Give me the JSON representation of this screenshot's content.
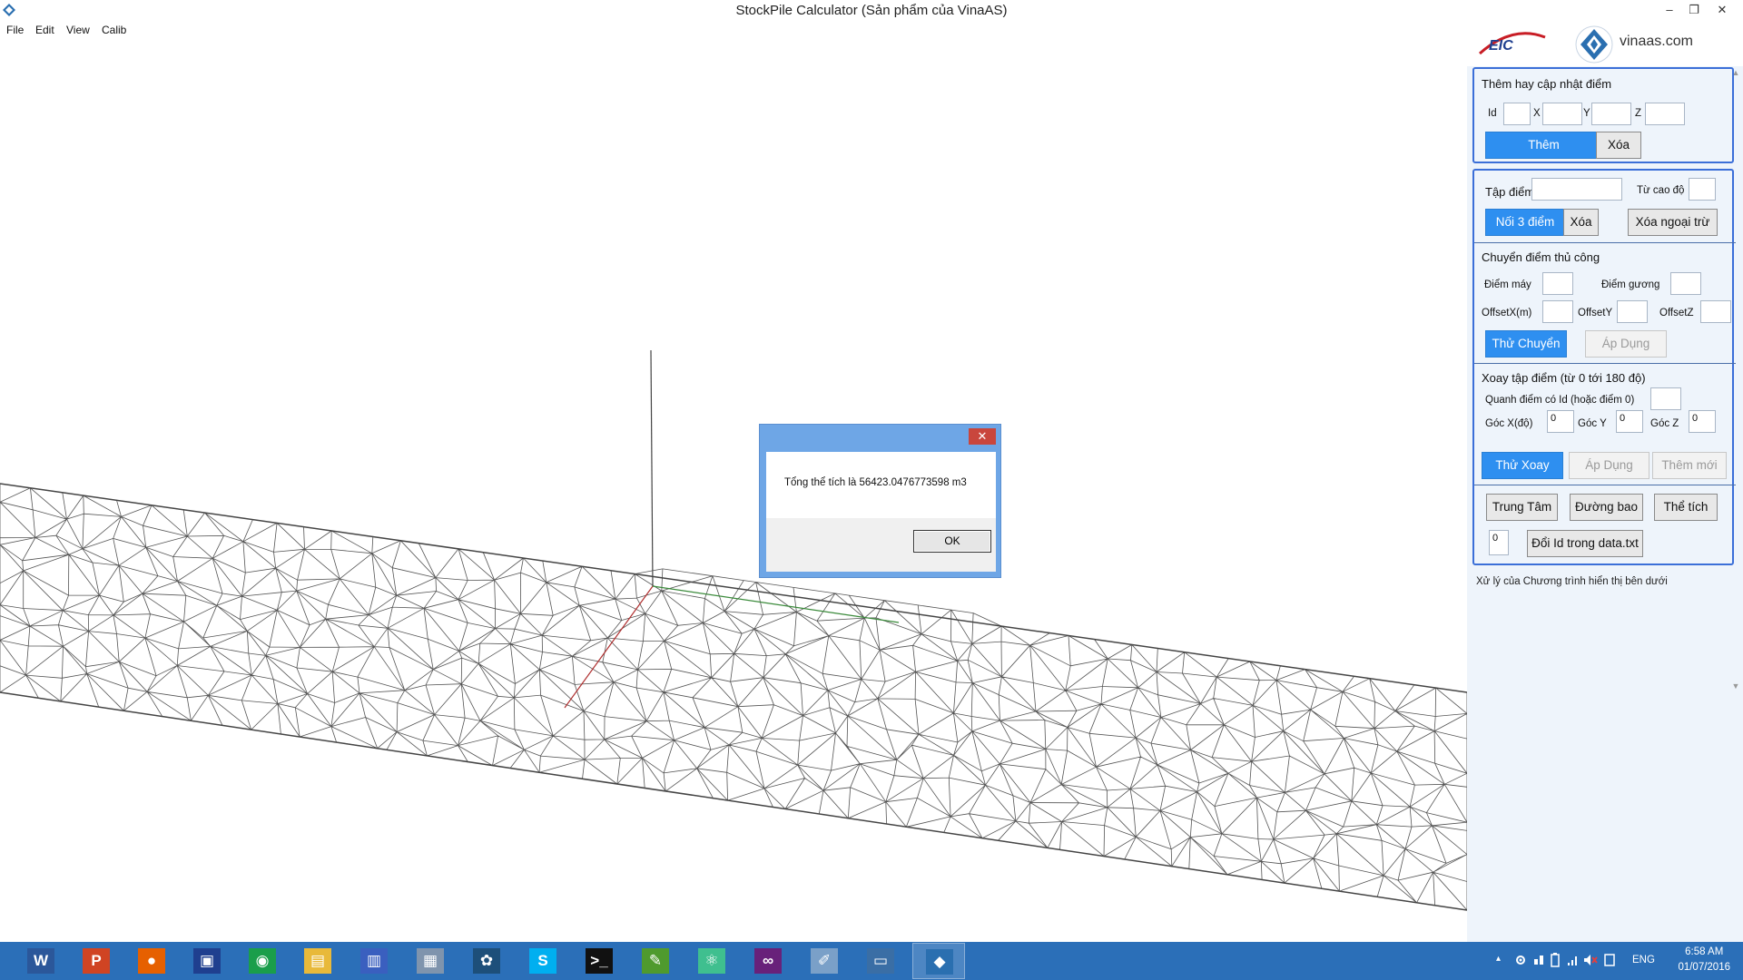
{
  "window": {
    "title": "StockPile Calculator (Sản phẩm của VinaAS)",
    "minimize_glyph": "–",
    "restore_glyph": "❐",
    "close_glyph": "✕"
  },
  "menu": [
    "File",
    "Edit",
    "View",
    "Calib"
  ],
  "logos": {
    "eic": "EIC",
    "vinaas": "vinaas.com"
  },
  "add_point": {
    "title": "Thêm hay cập nhật điểm",
    "id_label": "Id",
    "x_label": "X",
    "y_label": "Y",
    "z_label": "Z",
    "id_value": "",
    "x_value": "",
    "y_value": "",
    "z_value": "",
    "add_button": "Thêm",
    "delete_button": "Xóa"
  },
  "point_set": {
    "label": "Tập điểm",
    "value": "",
    "from_elevation_label": "Từ cao độ",
    "from_elevation_value": "",
    "connect3_button": "Nối 3 điểm",
    "delete_button": "Xóa",
    "delete_except_button": "Xóa ngoại trừ"
  },
  "manual_move": {
    "title": "Chuyển điểm thủ công",
    "machine_point_label": "Điểm máy",
    "mirror_point_label": "Điểm gương",
    "offset_x_label": "OffsetX(m)",
    "offset_y_label": "OffsetY",
    "offset_z_label": "OffsetZ",
    "try_button": "Thử Chuyển",
    "apply_button": "Áp Dụng"
  },
  "rotate": {
    "title": "Xoay tập điểm (từ 0 tới 180 độ)",
    "around_label": "Quanh điểm có Id (hoặc điểm 0)",
    "angle_x_label": "Góc X(độ)",
    "angle_y_label": "Góc Y",
    "angle_z_label": "Góc Z",
    "angle_x_value": "0",
    "angle_y_value": "0",
    "angle_z_value": "0",
    "try_button": "Thử Xoay",
    "apply_button": "Áp Dụng",
    "add_new_button": "Thêm mới"
  },
  "tools": {
    "center_button": "Trung Tâm",
    "boundary_button": "Đường bao",
    "volume_button": "Thể tích",
    "id_value": "0",
    "change_id_button": "Đổi Id trong data.txt"
  },
  "status_text": "Xử lý của Chương trình hiển thị bên dưới",
  "dialog": {
    "message": "Tổng thể tích là 56423.0476773598 m3",
    "ok_button": "OK",
    "close_glyph": "✕"
  },
  "taskbar": {
    "apps": [
      {
        "name": "word-icon",
        "glyph": "W",
        "color": "#2b579a"
      },
      {
        "name": "powerpoint-icon",
        "glyph": "P",
        "color": "#d04423"
      },
      {
        "name": "firefox-icon",
        "glyph": "●",
        "color": "#e66000"
      },
      {
        "name": "save-disk-icon",
        "glyph": "▣",
        "color": "#1f3f8f"
      },
      {
        "name": "chrome-icon",
        "glyph": "◉",
        "color": "#1a9e4b"
      },
      {
        "name": "file-explorer-icon",
        "glyph": "▤",
        "color": "#e8b93a"
      },
      {
        "name": "network-computer-icon",
        "glyph": "▥",
        "color": "#3a5fbf"
      },
      {
        "name": "image-viewer-icon",
        "glyph": "▦",
        "color": "#7f94ad"
      },
      {
        "name": "tree-app-icon",
        "glyph": "✿",
        "color": "#1d4f7a"
      },
      {
        "name": "skype-icon",
        "glyph": "S",
        "color": "#00aff0"
      },
      {
        "name": "command-prompt-icon",
        "glyph": ">_",
        "color": "#111111"
      },
      {
        "name": "chart-notepad-icon",
        "glyph": "✎",
        "color": "#4f9a2e"
      },
      {
        "name": "atom-editor-icon",
        "glyph": "⚛",
        "color": "#3fbf8f"
      },
      {
        "name": "visual-studio-icon",
        "glyph": "∞",
        "color": "#68217a"
      },
      {
        "name": "paint-icon",
        "glyph": "✐",
        "color": "#7aa0c8"
      },
      {
        "name": "remote-desktop-icon",
        "glyph": "▭",
        "color": "#3a6ea5"
      },
      {
        "name": "stockpile-app-icon",
        "glyph": "◆",
        "color": "#2a6fb0"
      }
    ],
    "language": "ENG",
    "time": "6:58 AM",
    "date": "01/07/2016",
    "tray_chevron": "▴"
  }
}
